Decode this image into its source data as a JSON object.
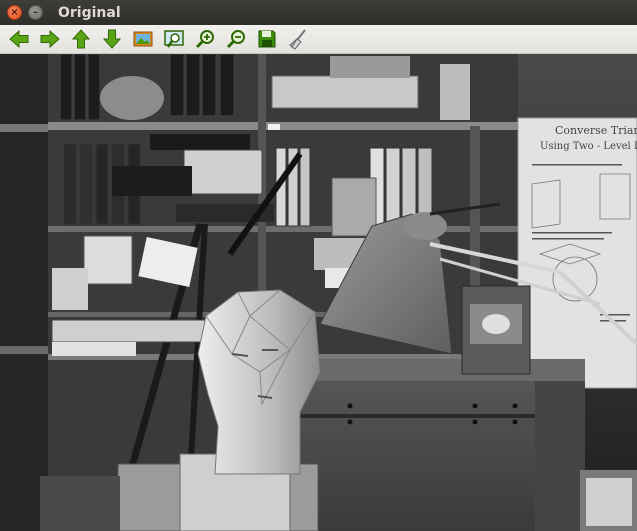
{
  "window": {
    "title": "Original",
    "close_glyph": "×",
    "minimize_glyph": "–"
  },
  "toolbar": {
    "buttons": [
      {
        "icon": "arrow-left-icon",
        "color": "#4e9a06"
      },
      {
        "icon": "arrow-right-icon",
        "color": "#4e9a06"
      },
      {
        "icon": "arrow-up-icon",
        "color": "#4e9a06"
      },
      {
        "icon": "arrow-down-icon",
        "color": "#4e9a06"
      },
      {
        "icon": "picture-icon",
        "color": "#c17d11"
      },
      {
        "icon": "zoom-region-icon",
        "color": "#4e9a06"
      },
      {
        "icon": "zoom-in-icon",
        "color": "#4e9a06"
      },
      {
        "icon": "zoom-out-icon",
        "color": "#4e9a06"
      },
      {
        "icon": "save-icon",
        "color": "#3a8a06"
      },
      {
        "icon": "broom-icon",
        "color": "#8a8a8a"
      }
    ]
  },
  "image": {
    "poster": {
      "heading": "Converse Triang",
      "subheading": "Using Two - Level D"
    }
  }
}
